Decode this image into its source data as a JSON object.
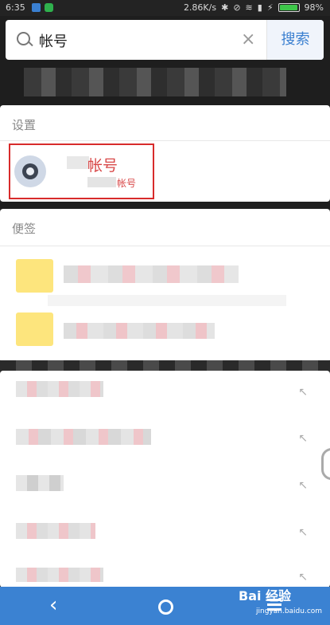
{
  "status_bar": {
    "time": "6:35",
    "network_speed": "2.86K/s",
    "battery_percent": "98%"
  },
  "search": {
    "query": "帐号",
    "button_label": "搜索"
  },
  "settings_section": {
    "title": "设置",
    "result_title": "帐号",
    "result_subtitle": "帐号"
  },
  "notes_section": {
    "title": "便签"
  },
  "navbar": {
    "watermark_brand": "Bai 经验",
    "watermark_url": "jingyan.baidu.com"
  },
  "colors": {
    "accent_blue": "#3b82d2",
    "highlight_red": "#d82b2b",
    "note_yellow": "#fde57d"
  }
}
